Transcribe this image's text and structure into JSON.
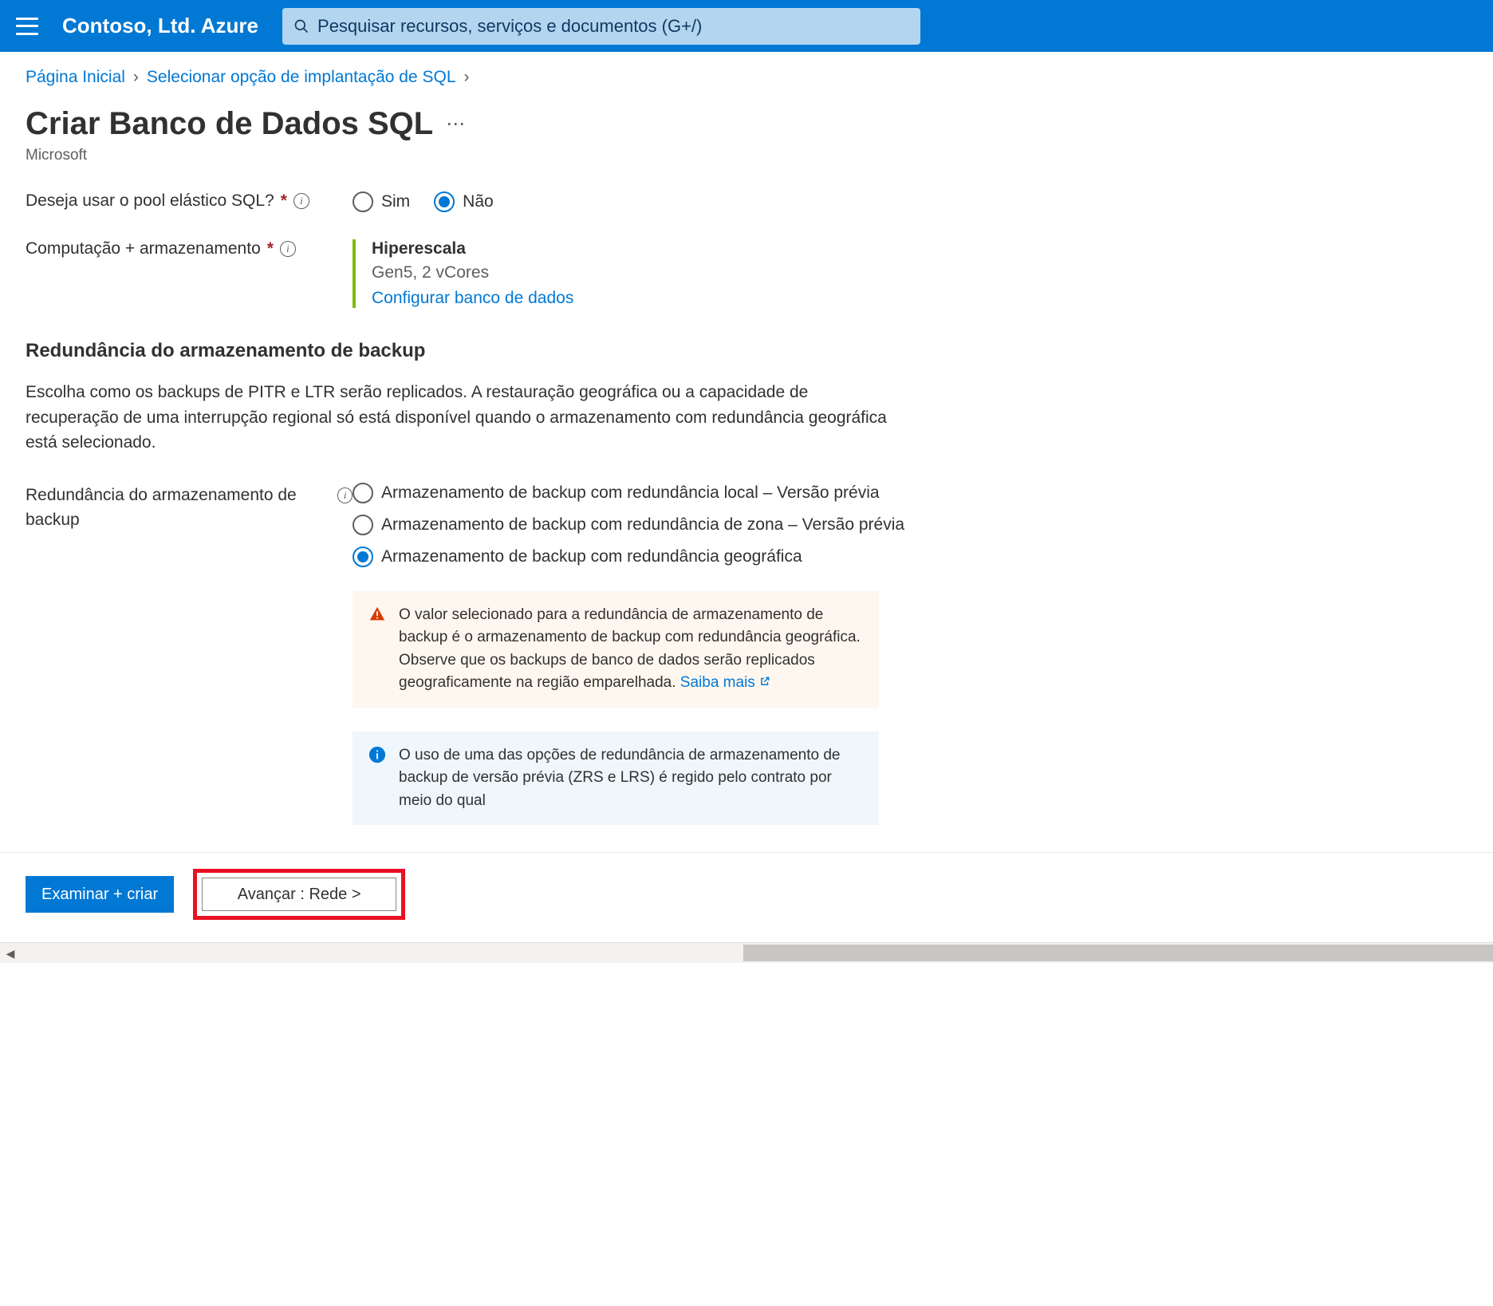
{
  "header": {
    "brand": "Contoso, Ltd. Azure",
    "search_placeholder": "Pesquisar recursos, serviços e documentos (G+/)"
  },
  "breadcrumb": {
    "home": "Página Inicial",
    "step2": "Selecionar opção de implantação de SQL"
  },
  "page": {
    "title": "Criar Banco de Dados SQL",
    "subtitle": "Microsoft"
  },
  "form": {
    "elastic_pool_label": "Deseja usar o pool elástico SQL?",
    "yes": "Sim",
    "no": "Não",
    "compute_label": "Computação + armazenamento",
    "compute_tier": "Hiperescala",
    "compute_spec": "Gen5, 2 vCores",
    "compute_link": "Configurar banco de dados"
  },
  "backup": {
    "heading": "Redundância do armazenamento de backup",
    "description": "Escolha como os backups de PITR e LTR serão replicados. A restauração geográfica ou a capacidade de recuperação de uma interrupção regional só está disponível quando o armazenamento com redundância geográfica está selecionado.",
    "redundancy_label": "Redundância do armazenamento de backup",
    "options": {
      "local": "Armazenamento de backup com redundância local – Versão prévia",
      "zone": "Armazenamento de backup com redundância de zona – Versão prévia",
      "geo": "Armazenamento de backup com redundância geográfica"
    },
    "warning_text": "O valor selecionado para a redundância de armazenamento de backup é o armazenamento de backup com redundância geográfica. Observe que os backups de banco de dados serão replicados geograficamente na região emparelhada. ",
    "warning_link": "Saiba mais",
    "info_text": "O uso de uma das opções de redundância de armazenamento de backup de versão prévia (ZRS e LRS) é regido pelo contrato por meio do qual"
  },
  "footer": {
    "review": "Examinar + criar",
    "next": "Avançar : Rede >"
  }
}
